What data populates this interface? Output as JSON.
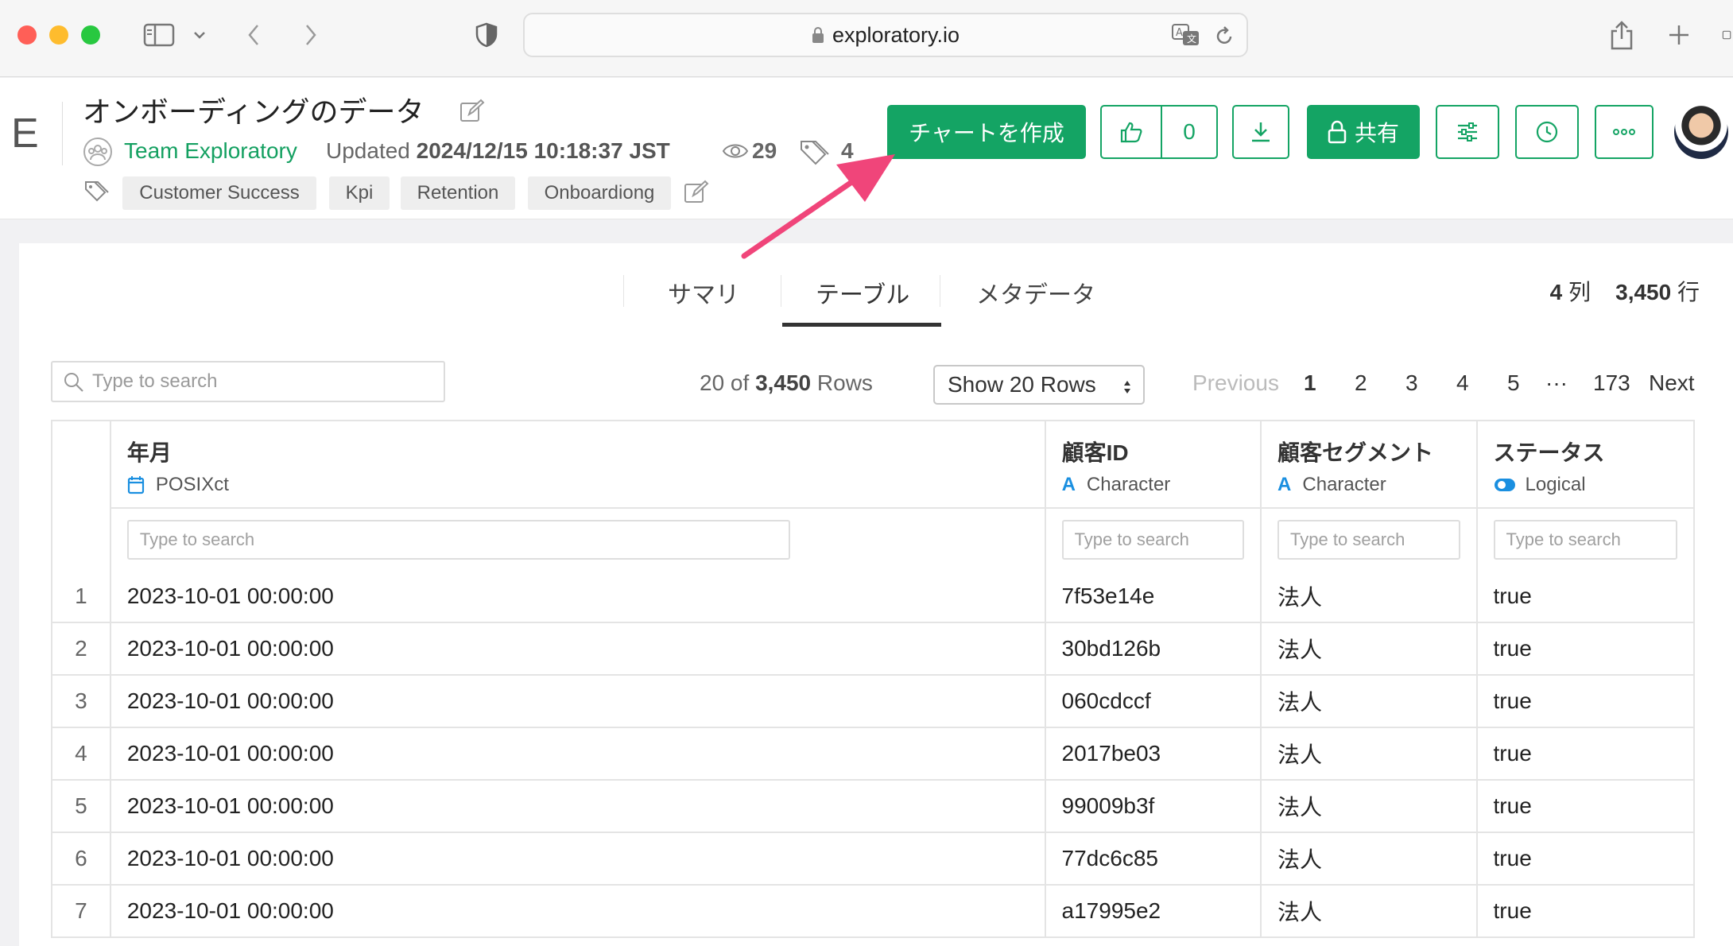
{
  "browser": {
    "url": "exploratory.io",
    "traffic_lights": [
      "#ff5f57",
      "#febc2e",
      "#28c840"
    ]
  },
  "header": {
    "title": "オンボーディングのデータ",
    "team": "Team Exploratory",
    "updated_prefix": "Updated",
    "updated_value": "2024/12/15 10:18:37 JST",
    "views": "29",
    "tag_count": "4",
    "tags": [
      "Customer Success",
      "Kpi",
      "Retention",
      "Onboardiong"
    ],
    "create_chart_label": "チャートを作成",
    "likes": "0",
    "share_label": "共有",
    "accent_color": "#14a464"
  },
  "view_tabs": [
    "サマリ",
    "テーブル",
    "メタデータ"
  ],
  "active_tab": "テーブル",
  "dims": {
    "cols_value": "4",
    "cols_label": "列",
    "rows_value": "3,450",
    "rows_label": "行"
  },
  "toolbar": {
    "search_placeholder": "Type to search",
    "rows_shown_prefix": "20 of",
    "rows_total": "3,450",
    "rows_suffix": "Rows",
    "show_rows": "Show 20 Rows"
  },
  "pagination": {
    "previous": "Previous",
    "pages": [
      "1",
      "2",
      "3",
      "4",
      "5"
    ],
    "ellipsis": "···",
    "last": "173",
    "next": "Next",
    "current": "1"
  },
  "table": {
    "columns": [
      {
        "name": "年月",
        "type": "POSIXct",
        "type_icon": "calendar-icon"
      },
      {
        "name": "顧客ID",
        "type": "Character",
        "type_icon": "character-icon"
      },
      {
        "name": "顧客セグメント",
        "type": "Character",
        "type_icon": "character-icon"
      },
      {
        "name": "ステータス",
        "type": "Logical",
        "type_icon": "toggle-icon"
      }
    ],
    "filter_placeholder": "Type to search",
    "rows": [
      [
        "1",
        "2023-10-01 00:00:00",
        "7f53e14e",
        "法人",
        "true"
      ],
      [
        "2",
        "2023-10-01 00:00:00",
        "30bd126b",
        "法人",
        "true"
      ],
      [
        "3",
        "2023-10-01 00:00:00",
        "060cdccf",
        "法人",
        "true"
      ],
      [
        "4",
        "2023-10-01 00:00:00",
        "2017be03",
        "法人",
        "true"
      ],
      [
        "5",
        "2023-10-01 00:00:00",
        "99009b3f",
        "法人",
        "true"
      ],
      [
        "6",
        "2023-10-01 00:00:00",
        "77dc6c85",
        "法人",
        "true"
      ],
      [
        "7",
        "2023-10-01 00:00:00",
        "a17995e2",
        "法人",
        "true"
      ]
    ]
  },
  "annotation_arrow_color": "#f0457a"
}
